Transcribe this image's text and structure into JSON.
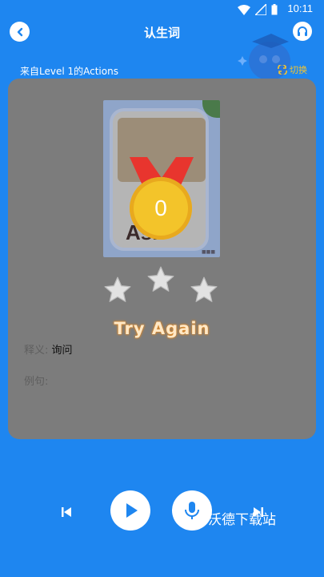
{
  "status_bar": {
    "time": "10:11"
  },
  "header": {
    "title": "认生词"
  },
  "source": {
    "text": "来自Level 1的Actions"
  },
  "switch": {
    "label": "切换"
  },
  "card": {
    "picture_word": "Ask",
    "score": "0",
    "stars": 3,
    "result_text": "Try Again",
    "definition_label": "释义:",
    "definition_value": "询问",
    "example_label": "例句:"
  },
  "watermark": "沃德下载站",
  "colors": {
    "background": "#1E86F0",
    "card_overlay": "#7C7C7C",
    "switch_accent": "#F5C430",
    "medal": "#F3C42A",
    "ribbon": "#E8352E"
  },
  "icons": [
    "back-arrow-icon",
    "headset-icon",
    "switch-arrows-icon",
    "star-icon",
    "skip-previous-icon",
    "play-icon",
    "microphone-icon",
    "skip-next-icon",
    "wifi-icon",
    "signal-icon",
    "battery-icon"
  ]
}
